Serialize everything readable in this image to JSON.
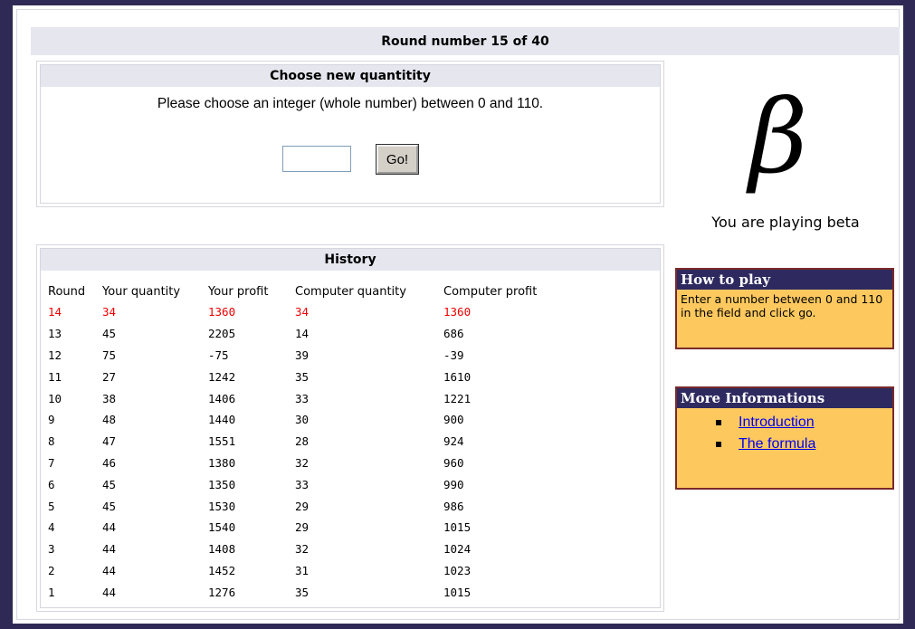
{
  "round_bar": {
    "text": "Round number 15 of 40"
  },
  "choose": {
    "title": "Choose new quantitity",
    "instruction": "Please choose an integer (whole number) between 0 and 110.",
    "input_value": "",
    "go_label": "Go!"
  },
  "history": {
    "title": "History",
    "columns": [
      "Round",
      "Your quantity",
      "Your profit",
      "Computer quantity",
      "Computer profit"
    ],
    "rows": [
      [
        "14",
        "34",
        "1360",
        "34",
        "1360"
      ],
      [
        "13",
        "45",
        "2205",
        "14",
        "686"
      ],
      [
        "12",
        "75",
        "-75",
        "39",
        "-39"
      ],
      [
        "11",
        "27",
        "1242",
        "35",
        "1610"
      ],
      [
        "10",
        "38",
        "1406",
        "33",
        "1221"
      ],
      [
        "9",
        "48",
        "1440",
        "30",
        "900"
      ],
      [
        "8",
        "47",
        "1551",
        "28",
        "924"
      ],
      [
        "7",
        "46",
        "1380",
        "32",
        "960"
      ],
      [
        "6",
        "45",
        "1350",
        "33",
        "990"
      ],
      [
        "5",
        "45",
        "1530",
        "29",
        "986"
      ],
      [
        "4",
        "44",
        "1540",
        "29",
        "1015"
      ],
      [
        "3",
        "44",
        "1408",
        "32",
        "1024"
      ],
      [
        "2",
        "44",
        "1452",
        "31",
        "1023"
      ],
      [
        "1",
        "44",
        "1276",
        "35",
        "1015"
      ]
    ],
    "highlight_color": "#ee0000"
  },
  "beta": {
    "symbol": "β",
    "label": "You are playing beta"
  },
  "how_to_play": {
    "title": "How to play",
    "text": "Enter a number between 0 and 110 in the field and click go."
  },
  "more_info": {
    "title": "More Informations",
    "links": [
      "Introduction",
      "The formula"
    ]
  },
  "colors": {
    "frame": "#2e2a55",
    "header_bg": "#e6e6ef",
    "sidebox_bg": "#fdc95f",
    "sidebox_head": "#2e2a60",
    "sidebox_border": "#7a2a2a",
    "link": "#0000ee"
  }
}
